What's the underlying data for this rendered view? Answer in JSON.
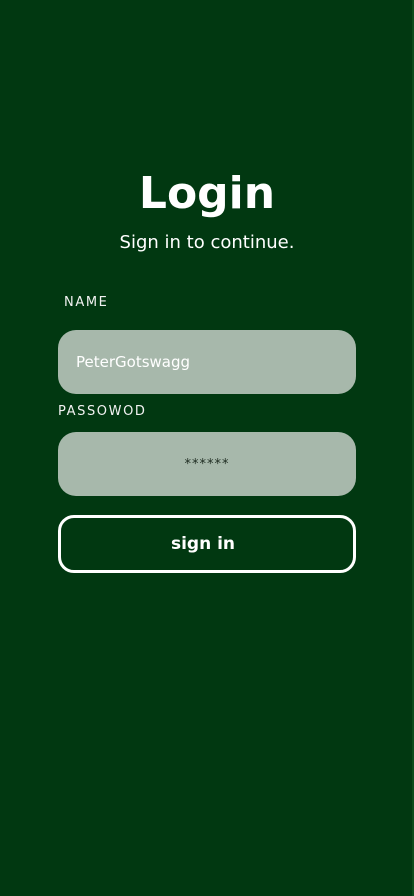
{
  "header": {
    "title": "Login",
    "subtitle": "Sign in to continue."
  },
  "form": {
    "name_label": "NAME",
    "name_value": "PeterGotswagg",
    "password_label": "PASSOWOD",
    "password_value": "******",
    "submit_label": "sign in"
  },
  "colors": {
    "background": "#013811",
    "input_fill": "#a7b8ab",
    "text": "#ffffff"
  }
}
